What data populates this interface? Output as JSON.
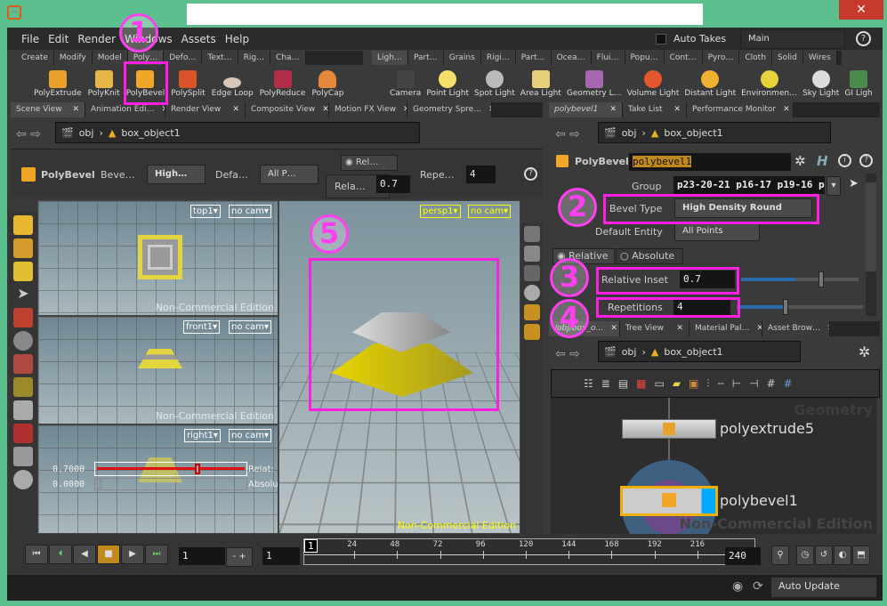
{
  "window": {
    "close_icon": "✕",
    "app_icon": "houdini-logo"
  },
  "menu": {
    "items": [
      "File",
      "Edit",
      "Render",
      "Windows",
      "Assets",
      "Help"
    ],
    "auto_takes": "Auto Takes",
    "desktop": "Main",
    "help": "?"
  },
  "shelf_left": {
    "tabs": [
      "Create",
      "Modify",
      "Model",
      "Poly…",
      "Defo…",
      "Text…",
      "Rig…",
      "Cha…"
    ],
    "tools": [
      "PolyExtrude",
      "PolyKnit",
      "PolyBevel",
      "PolySplit",
      "Edge Loop",
      "PolyReduce",
      "PolyCap"
    ]
  },
  "shelf_right": {
    "tabs": [
      "Ligh…",
      "Part…",
      "Grains",
      "Rigi…",
      "Part…",
      "Ocea…",
      "Flui…",
      "Popu…",
      "Cont…",
      "Pyro…",
      "Cloth",
      "Solid",
      "Wires"
    ],
    "tools": [
      "Camera",
      "Point Light",
      "Spot Light",
      "Area Light",
      "Geometry L…",
      "Volume Light",
      "Distant Light",
      "Environmen…",
      "Sky Light",
      "GI Ligh"
    ]
  },
  "scene_tabs": [
    "Scene View",
    "Animation Edi…",
    "Render View",
    "Composite View",
    "Motion FX View",
    "Geometry Spre…"
  ],
  "path": {
    "root": "obj",
    "object": "box_object1"
  },
  "op_toolbar": {
    "node_type": "PolyBevel",
    "bevel_label": "Beve…",
    "bevel_value": "High…",
    "default_label": "Defa…",
    "default_value": "All P…",
    "rel_tab": "Rel…",
    "rela_label": "Rela…",
    "rela_value": "0.7",
    "repe_label": "Repe…",
    "repe_value": "4",
    "help": "?"
  },
  "viewports": {
    "top": {
      "view": "top1▾",
      "cam": "no cam▾"
    },
    "front": {
      "view": "front1▾",
      "cam": "no cam▾"
    },
    "right": {
      "view": "right1▾",
      "cam": "no cam▾"
    },
    "persp": {
      "view": "persp1▾",
      "cam": "no cam▾"
    },
    "watermark": "Non-Commercial Edition",
    "handle_rel_value": "0.7000",
    "handle_rel_label": "Relat:",
    "handle_abs_value": "0.0000",
    "handle_abs_label": "Absolu"
  },
  "param_tabs": [
    "polybevel1",
    "Take List",
    "Performance Monitor"
  ],
  "params": {
    "node_type": "PolyBevel",
    "node_name": "polybevel1",
    "group_label": "Group",
    "group_value": "p23-20-21 p16-17 p19-16 p2",
    "bevel_type_label": "Bevel Type",
    "bevel_type_value": "High Density Round",
    "default_entity_label": "Default Entity",
    "default_entity_value": "All Points",
    "mode_tabs": [
      "Relative",
      "Absolute"
    ],
    "relative_inset_label": "Relative Inset",
    "relative_inset_value": "0.7",
    "relative_inset_fraction": 0.7,
    "repetitions_label": "Repetitions",
    "repetitions_value": "4"
  },
  "network_tabs": [
    "/obj/box_o…",
    "Tree View",
    "Material Pal…",
    "Asset Brow…"
  ],
  "network": {
    "context_label": "Geometry",
    "nodes": [
      "polyextrude5",
      "polybevel1"
    ],
    "watermark": "Non-Commercial Edition"
  },
  "timeline": {
    "current_frame": "1",
    "step": "1",
    "start": "1",
    "end": "240",
    "ticks": [
      "24",
      "48",
      "72",
      "96",
      "120",
      "144",
      "168",
      "192",
      "216"
    ],
    "marker": "1"
  },
  "status": {
    "update_mode": "Auto Update"
  },
  "annotations": [
    "1",
    "2",
    "3",
    "4",
    "5"
  ],
  "colors": {
    "annotation": "#ff1fe0",
    "selection": "#f0b000",
    "frame": "#5cbf8e"
  }
}
